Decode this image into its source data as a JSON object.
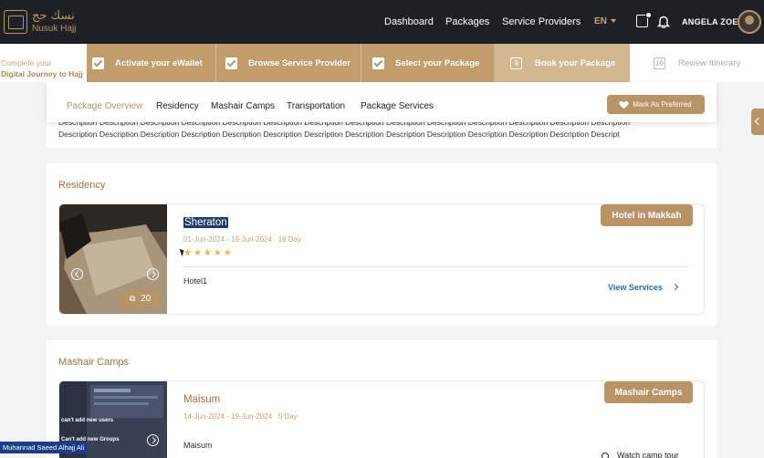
{
  "header": {
    "logo_ar": "نسك حج",
    "logo_en": "Nusuk Hajj",
    "nav": [
      "Dashboard",
      "Packages",
      "Service Providers"
    ],
    "language": "EN",
    "user_name": "ANGELA ZOE"
  },
  "steps": {
    "intro_line1": "Complete your",
    "intro_line2": "Digital Journey to Hajj",
    "items": [
      {
        "label": "Activate your eWallet",
        "state": "done"
      },
      {
        "label": "Browse Service Provider",
        "state": "done"
      },
      {
        "label": "Select your Package",
        "state": "done"
      },
      {
        "label": "Book your Package",
        "number": "9",
        "state": "current"
      },
      {
        "label": "Review Itinerary",
        "number": "10",
        "state": "upcoming"
      }
    ]
  },
  "tabs": {
    "items": [
      "Package Overview",
      "Residency",
      "Mashair Camps",
      "Transportation",
      "Package Services"
    ],
    "active": "Package Overview",
    "mark_preferred": "Mark As Preferred"
  },
  "description": {
    "line1": "Description Description Description Description Description Description Description Description Description Description Description Description Description Description",
    "line2": "Description Description Description Description Description Description Description Description Description Description Description Description Description Descript"
  },
  "residency": {
    "title": "Residency",
    "hotel": {
      "name": "Sheraton",
      "dates": "01-Jun-2024 - 19-Jun-2024",
      "duration": "18 Day",
      "stars": "★★★★★",
      "rating": 5,
      "description": "Hotel1",
      "image_count": "20",
      "badge": "Hotel in Makkah",
      "view_services": "View Services"
    }
  },
  "mashair": {
    "title": "Mashair Camps",
    "camp": {
      "name": "Maisum",
      "dates": "14-Jun-2024 - 19-Jun-2024",
      "duration": "5 Day",
      "description": "Maisum",
      "badge": "Mashair Camps",
      "watch_tour": "Watch camp tour",
      "thumb_line1": "can't add new users",
      "thumb_line2": "Can't add new Groups"
    }
  },
  "caption": "Muhannad Saeed Alhajj Ali",
  "colors": {
    "gold": "#b89465",
    "dark_header": "#1f2026",
    "link_blue": "#2b6cb0"
  }
}
